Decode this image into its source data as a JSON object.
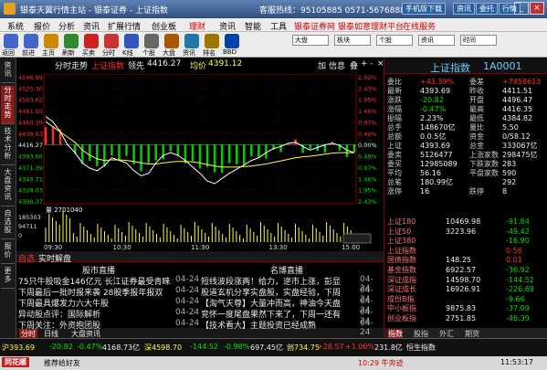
{
  "window": {
    "title": "银泰天翼行情主站 - 银泰证券 - 上证指数",
    "hotline": "客服热线：95105885  0571-56768888",
    "mobile_btn": "手机版下载",
    "news_btn": "资讯",
    "trade_btn": "委托",
    "switch_btn": "行情"
  },
  "menu": [
    "系统",
    "报价",
    "分析",
    "资讯",
    "扩展行情",
    "创业板",
    "理财",
    "资讯",
    "智能",
    "工具",
    "银泰证券网",
    "银泰如意理财平台",
    "在线服务"
  ],
  "toolbar": {
    "items": [
      {
        "label": "返回",
        "color": "#4466cc"
      },
      {
        "label": "前进",
        "color": "#4466cc"
      },
      {
        "label": "主页",
        "color": "#cc8800"
      },
      {
        "label": "刷新",
        "color": "#338833"
      },
      {
        "label": "买卖",
        "color": "#cc2222"
      },
      {
        "label": "分时",
        "color": "#cc3333"
      },
      {
        "label": "K线",
        "color": "#3355bb"
      },
      {
        "label": "个股",
        "color": "#666666"
      },
      {
        "label": "大盘",
        "color": "#aa5500"
      },
      {
        "label": "资讯",
        "color": "#2277aa"
      },
      {
        "label": "排名",
        "color": "#997700"
      },
      {
        "label": "BBD",
        "color": "#0044aa"
      }
    ],
    "select1": "大盘",
    "select2": "板块",
    "select3": "个股",
    "select4": "资讯",
    "select5": "时间"
  },
  "sidetabs": [
    "资讯",
    "分时走势",
    "技术分析",
    "大盘资讯",
    "自选股",
    "报价",
    "更多"
  ],
  "chart_header": {
    "tab": "分时走势",
    "index": "上证指数",
    "price_label": "领先",
    "price": "4416.27",
    "avg_label": "均价",
    "avg": "4391.12",
    "tools": [
      "加",
      "信息",
      "叠",
      "+",
      "-",
      "×"
    ]
  },
  "chart_data": {
    "type": "line",
    "title": "上证指数",
    "yaxis_left": [
      "4546.99",
      "4525.30",
      "4503.62",
      "4481.95",
      "4460.29",
      "4438.63",
      "4416.27",
      "4393.06",
      "4371.39",
      "4349.71",
      "4328.03",
      "4306.37"
    ],
    "yaxis_right": [
      "2.92%",
      "2.43%",
      "1.95%",
      "1.46%",
      "0.97%",
      "0.49%",
      "0.00%",
      "0.49%",
      "0.97%",
      "1.46%",
      "1.95%",
      "2.43%"
    ],
    "prev_close": 4416.27,
    "x_ticks": [
      "09:30",
      "10:30",
      "11:30",
      "13:30",
      "15:00"
    ],
    "volume_label": "量 2701040",
    "volume_ticks": [
      "185303",
      "94711",
      "0"
    ],
    "series": [
      {
        "values": [
          4470,
          4460,
          4440,
          4415,
          4400,
          4380,
          4370,
          4365,
          4375,
          4390,
          4385,
          4380,
          4365,
          4355,
          4360,
          4380,
          4395,
          4400,
          4395,
          4385,
          4372,
          4360,
          4345,
          4340,
          4350,
          4360,
          4368,
          4376,
          4385,
          4390,
          4400,
          4408,
          4412,
          4418,
          4420,
          4412,
          4405,
          4410,
          4415,
          4418,
          4414,
          4405,
          4400
        ]
      },
      {
        "values": [
          4460,
          4450,
          4440,
          4430,
          4420,
          4405,
          4395,
          4388,
          4385,
          4386,
          4386,
          4385,
          4383,
          4380,
          4378,
          4378,
          4380,
          4382,
          4383,
          4383,
          4382,
          4380,
          4377,
          4374,
          4372,
          4372,
          4372,
          4373,
          4374,
          4376,
          4378,
          4381,
          4384,
          4387,
          4390,
          4392,
          4393,
          4395,
          4397,
          4399,
          4400,
          4400,
          4400
        ]
      }
    ]
  },
  "quote": {
    "title": "上证指数",
    "code": "1A0001",
    "rows": [
      [
        "委比",
        "+43.39%",
        "委差",
        "+7858613"
      ],
      [
        "最新",
        "4393.69",
        "昨收",
        "4411.51"
      ],
      [
        "涨跌",
        "-20.82",
        "开盘",
        "4496.47"
      ],
      [
        "涨幅",
        "-0.47%",
        "最高",
        "4416.35"
      ],
      [
        "振幅",
        "2.23%",
        "最低",
        "4384.82"
      ],
      [
        "总手",
        "148670亿",
        "量比",
        "5.50"
      ],
      [
        "总额",
        "0.0.5亿",
        "资金",
        "0/58.12"
      ],
      [
        "上证",
        "4393.69",
        "总金",
        "333067亿"
      ],
      [
        "委卖",
        "5126477",
        "上涨家数",
        "298475亿"
      ],
      [
        "委买",
        "12985089",
        "下跌家数",
        "283"
      ],
      [
        "平均",
        "56.16",
        "平盘家数",
        "590"
      ],
      [
        "总笔",
        "180.99亿",
        "",
        "292"
      ],
      [
        "涨停",
        "16",
        "跌停",
        "8"
      ]
    ],
    "indices": [
      [
        "上证180",
        "10469.98",
        "-91.84"
      ],
      [
        "上证50",
        "3223.96",
        "-49.42"
      ],
      [
        "上证380",
        "",
        "-16.90"
      ],
      [
        "上证指数",
        "",
        "0.56"
      ],
      [
        "国债指数",
        "148.25",
        "0.01"
      ],
      [
        "基金指数",
        "6922.57",
        "-36.92"
      ],
      [
        "深证成指",
        "14598.70",
        "-144.52"
      ],
      [
        "深证成长",
        "16926.91",
        "-226.69"
      ],
      [
        "成份B指",
        "",
        "-9.66"
      ],
      [
        "中小板指",
        "9875.83",
        "-37.09"
      ],
      [
        "创业板指",
        "2751.85",
        "-46.39"
      ]
    ],
    "tabs": [
      "指数",
      "股指",
      "外汇",
      "期货"
    ]
  },
  "news": {
    "tabs": [
      "自选",
      "实时解盘"
    ],
    "col1": "股市直播",
    "col2": "名博直播",
    "items1": [
      {
        "t": "75只牛股吸金146亿元 长江证券最受青睐",
        "d": "04-24"
      },
      {
        "t": "下周最后一批时报来袭 28股季报年报双",
        "d": "04-24"
      },
      {
        "t": "下周最具爆发力六大牛股",
        "d": "04-24"
      },
      {
        "t": "异动股点评：国际解析",
        "d": "04-24"
      },
      {
        "t": "下周关注：外资抱团股",
        "d": "04-24"
      }
    ],
    "items2": [
      {
        "t": "短线波段涨两！给力，逆市上涨，彭显",
        "d": "04-24"
      },
      {
        "t": "股道玄机分享实盘股，实盘经验，下周",
        "d": "04-24"
      },
      {
        "t": "【淘气天尊】大量冲而高，神油今天盘",
        "d": "04-24"
      },
      {
        "t": "竞怀一度尾盘果然下来了，下周一还有",
        "d": "04-24"
      },
      {
        "t": "【技术看大】主题投资已经成熟",
        "d": "04-24"
      }
    ],
    "bottom_tabs": [
      "分时",
      "日线",
      "大盘资讯"
    ]
  },
  "status": {
    "sh": "沪393.69",
    "sh_chg": "-20.82",
    "sh_pct": "-0.47%",
    "sh_amt": "4168.73亿",
    "sz": "深4598.70",
    "sz_chg": "-144.52",
    "sz_pct": "-0.98%",
    "sz_amt": "697.45亿",
    "cyb": "创734.75",
    "cyb_chg": "+28.57",
    "cyb_pct": "+1.06%",
    "cyb_amt": "231.8亿",
    "hk": "恒生指数"
  },
  "bottombar": {
    "logo": "同花顺",
    "msg": "推荐给好友",
    "time": "10:29 牛奔迹",
    "clock": "11:53:17"
  }
}
